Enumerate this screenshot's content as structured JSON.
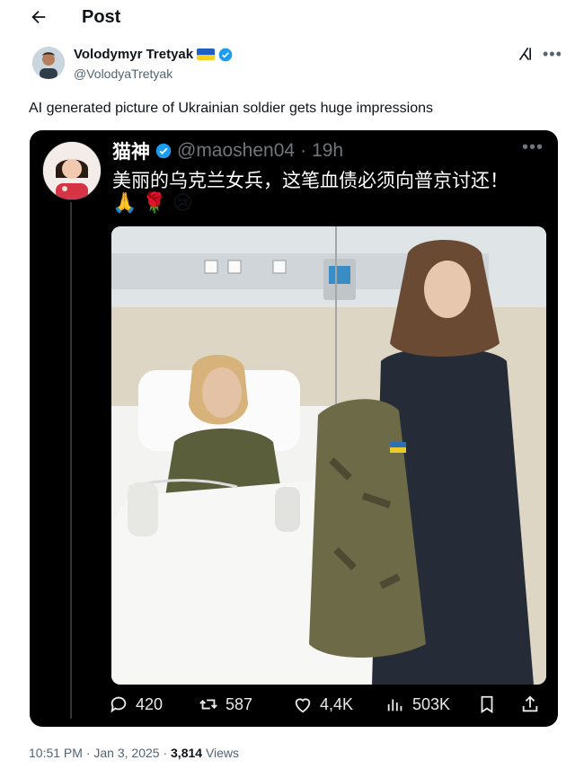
{
  "header": {
    "back_icon": "arrow-left-icon",
    "title": "Post"
  },
  "author": {
    "name": "Volodymyr Tretyak",
    "handle": "@VolodyaTretyak",
    "flag": "ukraine-flag-icon",
    "verified": "verified-badge-icon"
  },
  "tweet": {
    "text": "AI generated picture of Ukrainian soldier gets huge impressions"
  },
  "quoted": {
    "name": "猫神",
    "handle": "@maoshen04",
    "separator": "·",
    "time": "19h",
    "text": "美丽的乌克兰女兵，这笔血债必须向普京讨还！",
    "emojis": [
      "🙏",
      "🌹",
      "😢"
    ],
    "image_desc_icon": "hospital-photo"
  },
  "actions": {
    "replies": "420",
    "reposts": "587",
    "likes": "4,4K",
    "views": "503K"
  },
  "meta": {
    "time": "10:51 PM",
    "dot": "·",
    "date": "Jan 3, 2025",
    "dot2": "·",
    "views_count": "3,814",
    "views_label": "Views"
  },
  "colors": {
    "accent": "#1d9bf0",
    "dark_bg": "#000000",
    "muted": "#536471"
  }
}
